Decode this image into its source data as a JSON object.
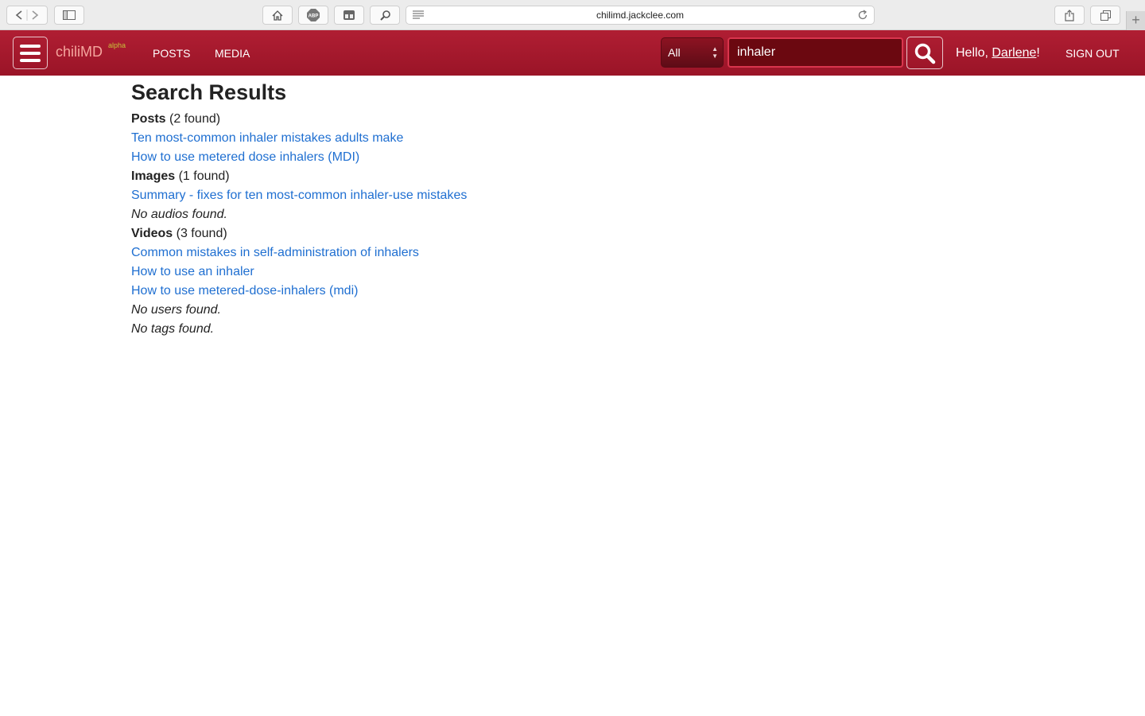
{
  "browser": {
    "url": "chilimd.jackclee.com",
    "new_tab_symbol": "+"
  },
  "navbar": {
    "brand": "chiliMD",
    "brand_sup": "alpha",
    "links": [
      "POSTS",
      "MEDIA"
    ],
    "search_scope": "All",
    "search_value": "inhaler",
    "greeting_prefix": "Hello, ",
    "user_name": "Darlene",
    "greeting_suffix": "!",
    "sign_out": "SIGN OUT"
  },
  "results": {
    "title": "Search Results",
    "posts": {
      "label": "Posts",
      "count": "(2 found)",
      "items": [
        "Ten most-common inhaler mistakes adults make",
        "How to use metered dose inhalers (MDI)"
      ]
    },
    "images": {
      "label": "Images",
      "count": "(1 found)",
      "items": [
        "Summary - fixes for ten most-common inhaler-use mistakes"
      ]
    },
    "audios_none": "No audios found.",
    "videos": {
      "label": "Videos",
      "count": "(3 found)",
      "items": [
        "Common mistakes in self-administration of inhalers",
        "How to use an inhaler",
        "How to use metered-dose-inhalers (mdi)"
      ]
    },
    "users_none": "No users found.",
    "tags_none": "No tags found."
  },
  "colors": {
    "navbar": "#a31a2d",
    "link": "#1f6fd1",
    "brand": "#f4a59d"
  }
}
